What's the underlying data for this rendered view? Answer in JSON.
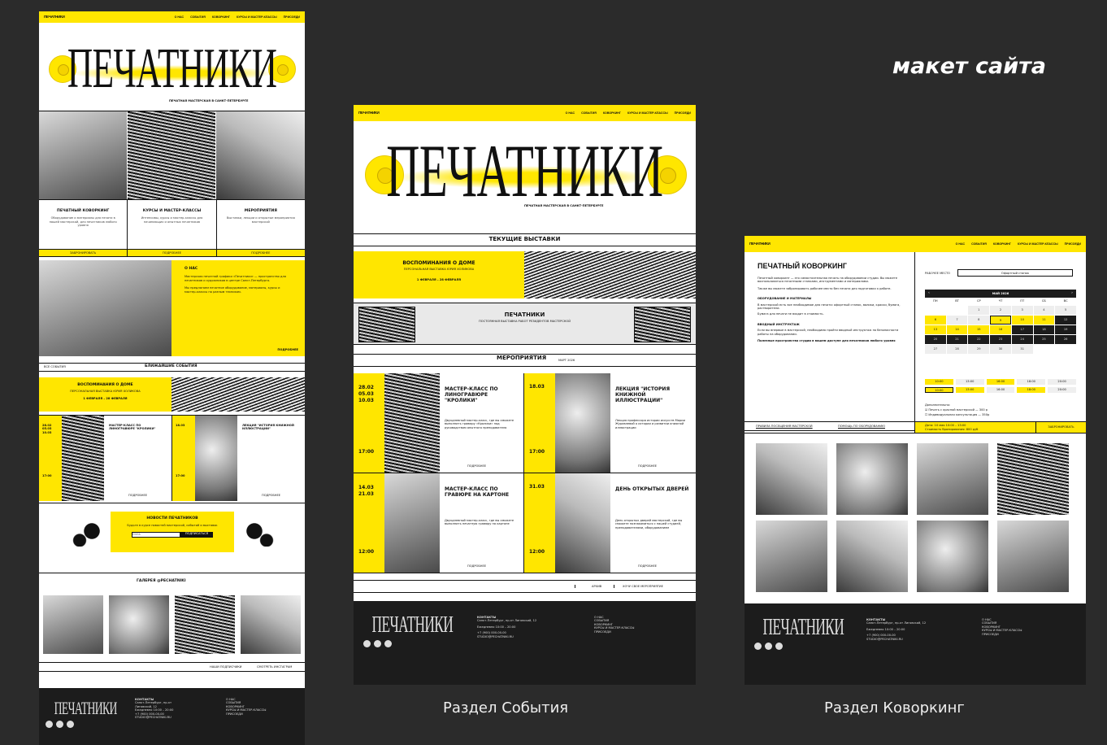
{
  "caption_top": "макет сайта",
  "caption_events": "Раздел События",
  "caption_cowork": "Раздел Коворкинг",
  "brand": {
    "logo": "ПЕЧАТНИКИ",
    "title": "ПЕЧАТНИКИ",
    "subtitle": "ПЕЧАТНАЯ МАСТЕРСКАЯ В САНКТ-ПЕТЕРБУРГЕ"
  },
  "nav": {
    "about": "О НАС",
    "events": "СОБЫТИЯ",
    "cowork": "КОВОРКИНГ",
    "courses": "КУРСЫ И МАСТЕР-КЛАССЫ",
    "contacts": "ПРИСОЕДИ"
  },
  "home": {
    "services": [
      {
        "title": "ПЕЧАТНЫЙ КОВОРКИНГ",
        "text": "Оборудование и материалы для печати в нашей мастерской, для печатников любого уровня",
        "btn": "ЗАБРОНИРОВАТЬ"
      },
      {
        "title": "КУРСЫ И МАСТЕР-КЛАССЫ",
        "text": "Интенсивы, курсы и мастер-классы для начинающих и опытных печатников",
        "btn": "ПОДРОБНЕЕ"
      },
      {
        "title": "МЕРОПРИЯТИЯ",
        "text": "Выставки, лекции и открытые мероприятия мастерской",
        "btn": "ПОДРОБНЕЕ"
      }
    ],
    "about_title": "О НАС",
    "about_text1": "Мастерская печатной графики «Печатники» — пространство для печатников и художников в центре Санкт-Петербурга.",
    "about_text2": "Мы предлагаем печатное оборудование, материалы, курсы и мастер-классы по разным техникам.",
    "about_more": "ПОДРОБНЕЕ",
    "events_all": "ВСЕ СОБЫТИЯ",
    "events_title": "БЛИЖАЙШИЕ СОБЫТИЯ",
    "banner_title": "ВОСПОМИНАНИЯ О ДОМЕ",
    "banner_sub": "ПЕРСОНАЛЬНАЯ ВЫСТАВКА ЮРИЯ ХОЛИКОВА",
    "banner_date": "1 ФЕВРАЛЯ – 28 ФЕВРАЛЯ",
    "ev1_dates": "28.02\n05.03\n10.03",
    "ev1_title": "МАСТЕР-КЛАСС ПО ЛИНОГРАВЮРЕ \"КРОЛИКИ\"",
    "ev1_time": "17:00",
    "ev2_dates": "18.03",
    "ev2_title": "ЛЕКЦИЯ \"ИСТОРИЯ КНИЖНОЙ ИЛЛЮСТРАЦИИ\"",
    "ev2_time": "17:00",
    "more": "ПОДРОБНЕЕ",
    "news_title": "НОВОСТИ ПЕЧАТНИКОВ",
    "news_text": "Будьте в курсе новостей мастерской, событий и выставок",
    "news_placeholder": "EMAIL",
    "news_btn": "ПОДПИСАТЬСЯ",
    "gallery_title": "ГАЛЕРЕЯ @PECHATNIKI",
    "gallery_btn1": "НАШИ ПОДПИСЧИКИ",
    "gallery_btn2": "СМОТРЕТЬ ИНСТАГРАМ"
  },
  "events": {
    "current_title": "ТЕКУЩИЕ ВЫСТАВКИ",
    "exh1_title": "ВОСПОМИНАНИЯ О ДОМЕ",
    "exh1_sub": "ПЕРСОНАЛЬНАЯ ВЫСТАВКА ЮРИЯ ХОЛИКОВА",
    "exh1_date": "1 ФЕВРАЛЯ – 28 ФЕВРАЛЯ",
    "exh2_title": "ПЕЧАТНИКИ",
    "exh2_sub": "ПОСТОЯННАЯ ВЫСТАВКА РАБОТ РЕЗИДЕНТОВ МАСТЕРСКОЙ",
    "events_title": "МЕРОПРИЯТИЯ",
    "events_month": "МАРТ 2026",
    "cards": [
      {
        "dates": "28.02\n05.03\n10.03",
        "time": "17:00",
        "title": "МАСТЕР-КЛАСС ПО ЛИНОГРАВЮРЕ \"КРОЛИКИ\"",
        "text": "Двухдневный мастер-класс, где вы сможете выполнить гравюру «Кролики» под руководством опытного преподавателя",
        "more": "ПОДРОБНЕЕ"
      },
      {
        "dates": "18.03",
        "time": "17:00",
        "title": "ЛЕКЦИЯ \"ИСТОРИЯ КНИЖНОЙ ИЛЛЮСТРАЦИИ\"",
        "text": "Лекция профессора истории искусств Марии Журавлевой о истории и развитии книжной иллюстрации",
        "more": "ПОДРОБНЕЕ"
      },
      {
        "dates": "14.03\n21.03",
        "time": "12:00",
        "title": "МАСТЕР-КЛАСС ПО ГРАВЮРЕ НА КАРТОНЕ",
        "text": "Двухдневный мастер-класс, где вы сможете выполнить печатную гравюру на картоне",
        "more": "ПОДРОБНЕЕ"
      },
      {
        "dates": "31.03",
        "time": "12:00",
        "title": "ДЕНЬ ОТКРЫТЫХ ДВЕРЕЙ",
        "text": "День открытых дверей мастерской, где вы сможете познакомиться с нашей студией, преподавателями, оборудованием",
        "more": "ПОДРОБНЕЕ"
      }
    ],
    "archive": "АРХИВ",
    "offer": "ХОЧУ СВОЕ МЕРОПРИЯТИЕ"
  },
  "footer": {
    "contacts_title": "КОНТАКТЫ",
    "address": "Санкт-Петербург, пр-кт Лиговский, 12",
    "hours": "Ежедневно 10:00 – 20:00",
    "phone": "+7 (900) 000-00-00",
    "email": "STUDIO@PECHATNIKI.RU",
    "links": [
      "О НАС",
      "СОБЫТИЯ",
      "КОВОРКИНГ",
      "КУРСЫ И МАСТЕР-КЛАССЫ",
      "ПРИСОЕДИ"
    ]
  },
  "cowork": {
    "title": "ПЕЧАТНЫЙ КОВОРКИНГ",
    "intro": "Печатный коворкинг — это самостоятельная печать на оборудовании студии. Вы можете воспользоваться печатными станками, инструментами и материалами.",
    "intro2": "Также вы можете забронировать рабочее место без печати для подготовки к работе.",
    "equip_title": "ОБОРУДОВАНИЕ И МАТЕРИАЛЫ",
    "equip_text": "В мастерской есть все необходимое для печати: офортный станок, валики, краски, бумага, растворители.",
    "equip_text2": "Бумага для печати не входит в стоимость.",
    "intro_title": "ВВОДНЫЙ ИНСТРУКТАЖ",
    "intro_text": "Если вы впервые в мастерской, необходимо пройти вводный инструктаж по безопасности работы на оборудовании.",
    "intro_text2": "Полезные пространства студии в вашем доступе для печатников любого уровня",
    "link1": "ПРАВИЛА ПОСЕЩЕНИЯ МАСТЕРСКОЙ",
    "link2": "ПОМОЩЬ ПО ОБОРУДОВАНИЮ",
    "place_label": "РАБОЧЕЕ МЕСТО",
    "place_value": "Офортный станок",
    "month": "МАЙ 2026",
    "weekdays": [
      "ПН",
      "ВТ",
      "СР",
      "ЧТ",
      "ПТ",
      "СБ",
      "ВС"
    ],
    "days": [
      "",
      "",
      "1",
      "2",
      "3",
      "4",
      "5",
      "6",
      "7",
      "8",
      "9",
      "10",
      "11",
      "12",
      "13",
      "14",
      "15",
      "16",
      "17",
      "18",
      "19",
      "20",
      "21",
      "22",
      "23",
      "24",
      "25",
      "26",
      "27",
      "28",
      "29",
      "30",
      "31",
      "",
      ""
    ],
    "day_states": [
      "e",
      "e",
      "n",
      "n",
      "n",
      "n",
      "n",
      "y",
      "n",
      "n",
      "s",
      "y",
      "y",
      "d",
      "y",
      "y",
      "y",
      "y",
      "d",
      "d",
      "d",
      "d",
      "d",
      "d",
      "d",
      "d",
      "d",
      "d",
      "n",
      "n",
      "n",
      "n",
      "n",
      "e",
      "e"
    ],
    "slots": [
      "10:00",
      "13:00",
      "16:00",
      "18:00",
      "20:00",
      "10:00",
      "13:00",
      "16:00",
      "18:00",
      "20:00"
    ],
    "extra_title": "Дополнительно:",
    "extra1": "Печать с красной мастерской — 300 р",
    "extra2": "Индивидуальная консультация — 350р",
    "summary": "Дата: 10 мая 10:00 – 13:00",
    "summary2": "Стоимость бронирования: 800 руб",
    "book_btn": "ЗАБРОНИРОВАТЬ"
  }
}
